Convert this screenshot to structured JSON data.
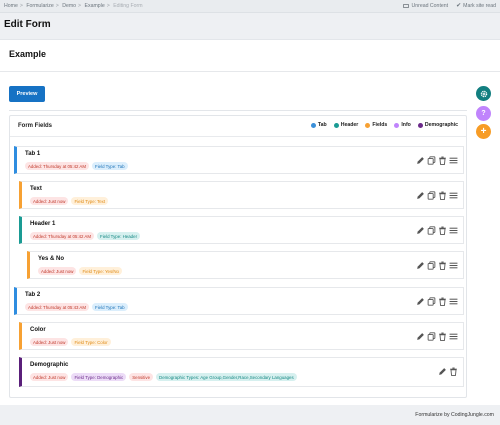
{
  "breadcrumb": [
    "Home",
    "Formularize",
    "Demo",
    "Example",
    "Editing Form"
  ],
  "breadcrumb_sep": ">",
  "top_actions": {
    "unread": "Unread Content",
    "mark_read": "Mark site read"
  },
  "page_title": "Edit Form",
  "form_name": "Example",
  "preview_label": "Preview",
  "fields_panel": {
    "title": "Form Fields",
    "legend": [
      {
        "label": "Tab",
        "color": "#3a8fd9"
      },
      {
        "label": "Header",
        "color": "#1a9b94"
      },
      {
        "label": "Fields",
        "color": "#f7a133"
      },
      {
        "label": "Info",
        "color": "#c084fc"
      },
      {
        "label": "Demographic",
        "color": "#6b2a8a"
      }
    ]
  },
  "fields": [
    {
      "title": "Tab 1",
      "tags": [
        "Added: Thursday at 05:42 AM",
        "Field Type: Tab"
      ]
    },
    {
      "title": "Text",
      "tags": [
        "Added: Just now",
        "Field Type: Text"
      ]
    },
    {
      "title": "Header 1",
      "tags": [
        "Added: Thursday at 05:42 AM",
        "Field Type: Header"
      ]
    },
    {
      "title": "Yes & No",
      "tags": [
        "Added: Just now",
        "Field Type: Yes/No"
      ]
    },
    {
      "title": "Tab 2",
      "tags": [
        "Added: Thursday at 05:43 AM",
        "Field Type: Tab"
      ]
    },
    {
      "title": "Color",
      "tags": [
        "Added: Just now",
        "Field Type: Color"
      ]
    },
    {
      "title": "Demographic",
      "tags": [
        "Added: Just now",
        "Field Type: Demographic",
        "Sensitive",
        "Demographic Types: Age Group,Gender,Race,Secondary Languages"
      ]
    }
  ],
  "row_colors": {
    "tab": "#2e8de0",
    "field": "#f7a133",
    "header": "#1a9b94",
    "demographic": "#5a1f7a"
  },
  "footer": "Formularize by CodingJungle.com",
  "icons": {
    "gear": "gear-icon",
    "help": "question-icon",
    "add": "plus-icon",
    "edit": "pencil-icon",
    "copy": "copy-icon",
    "delete": "trash-icon",
    "drag": "drag-handle-icon"
  }
}
